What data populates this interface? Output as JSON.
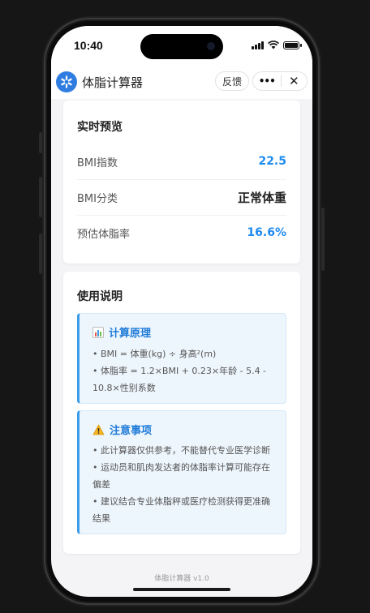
{
  "status": {
    "time": "10:40"
  },
  "app": {
    "title": "体脂计算器",
    "feedback_label": "反馈",
    "more_label": "•••",
    "close_label": "✕"
  },
  "preview": {
    "title": "实时预览",
    "rows": [
      {
        "label": "BMI指数",
        "value": "22.5",
        "color": "#1e8bf0"
      },
      {
        "label": "BMI分类",
        "value": "正常体重",
        "color": "#222222"
      },
      {
        "label": "预估体脂率",
        "value": "16.6%",
        "color": "#1e8bf0"
      }
    ]
  },
  "instructions": {
    "title": "使用说明",
    "principle": {
      "icon": "bar-chart-icon",
      "title": "计算原理",
      "line1": "• BMI = 体重(kg) ÷ 身高²(m)",
      "line2": "• 体脂率 = 1.2×BMI + 0.23×年龄 - 5.4 -",
      "line3": "10.8×性别系数"
    },
    "notes": {
      "icon": "warning-icon",
      "title": "注意事项",
      "line1": "• 此计算器仅供参考，不能替代专业医学诊断",
      "line2": "• 运动员和肌肉发达者的体脂率计算可能存在",
      "line3": "偏差",
      "line4": "• 建议结合专业体脂秤或医疗检测获得更准确",
      "line5": "结果"
    }
  },
  "footer": {
    "text": "体脂计算器 v1.0"
  },
  "colors": {
    "accent": "#1e8bf0",
    "background": "#f4f4f6"
  }
}
